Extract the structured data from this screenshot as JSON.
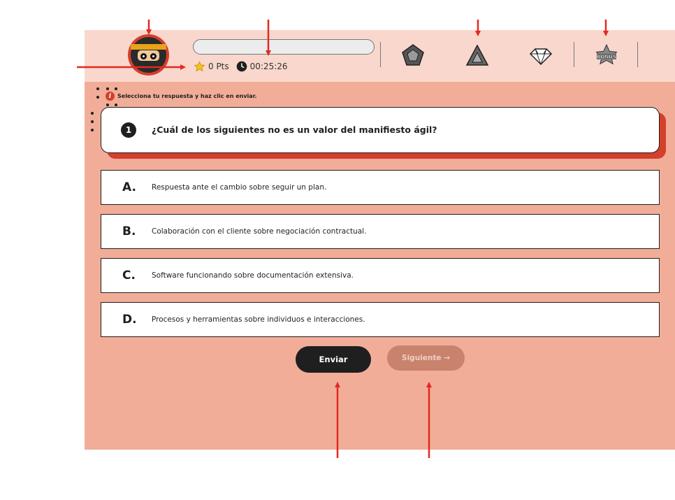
{
  "header": {
    "progress_fraction": 0,
    "points": "0 Pts",
    "timer": "00:25:26",
    "medals": [
      "pentagon-medal",
      "triangle-medal",
      "diamond-medal",
      "bonus-star-medal"
    ],
    "bonus_label": "BONUS"
  },
  "instruction": "Selecciona tu respuesta y haz clic en enviar.",
  "question": {
    "number": "1",
    "text": "¿Cuál de los siguientes no es un valor del manifiesto ágil?"
  },
  "options": [
    {
      "letter": "A.",
      "text": "Respuesta ante el cambio sobre seguir un plan."
    },
    {
      "letter": "B.",
      "text": "Colaboración con el cliente sobre negociación contractual."
    },
    {
      "letter": "C.",
      "text": "Software funcionando sobre documentación extensiva."
    },
    {
      "letter": "D.",
      "text": "Procesos y herramientas sobre individuos e interacciones."
    }
  ],
  "buttons": {
    "send": "Enviar",
    "next": "Siguiente →"
  },
  "colors": {
    "accent": "#d3402c",
    "panel": "#f2ad98",
    "topbar": "#f9d7cd",
    "dark": "#1f1f1f",
    "annotation_arrow": "#e02b20"
  }
}
